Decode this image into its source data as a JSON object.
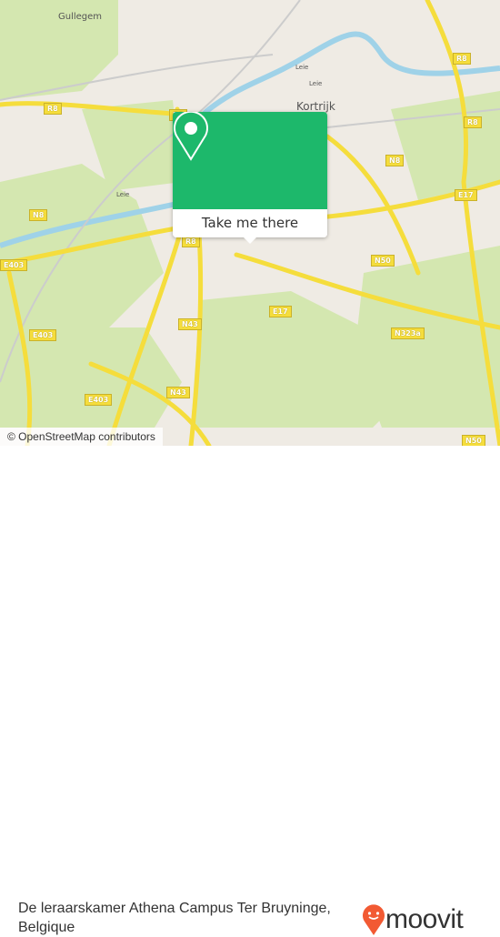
{
  "map": {
    "places": [
      "Gullegem",
      "Kortrijk"
    ],
    "rivers": [
      "Leie",
      "Leie",
      "Leie"
    ],
    "road_shields": [
      "R8",
      "R8",
      "R8",
      "R8",
      "N8",
      "N8",
      "E17",
      "E17",
      "N50",
      "N50",
      "E403",
      "E403",
      "E403",
      "N43",
      "N43",
      "N323a",
      "R8"
    ],
    "attribution": "© OpenStreetMap contributors",
    "colors": {
      "land": "#efebe4",
      "green": "#d4e7b0",
      "road": "#f5dd3c",
      "water": "#9fd2e8",
      "popup": "#1db86b"
    }
  },
  "popup": {
    "icon": "map-pin-icon",
    "button_label": "Take me there"
  },
  "footer": {
    "title": "De leraarskamer Athena Campus Ter Bruyninge, Belgique",
    "brand": "moovit",
    "brand_color": "#f25a33"
  }
}
